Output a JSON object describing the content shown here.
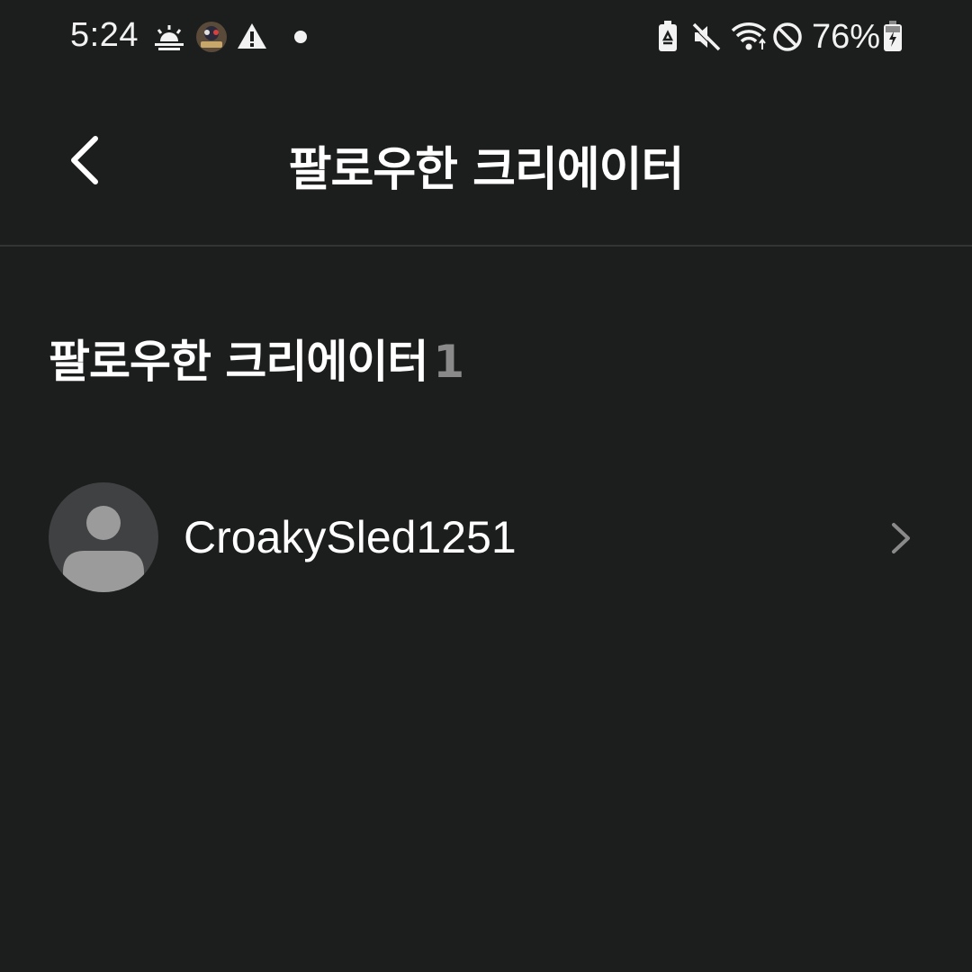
{
  "status_bar": {
    "time": "5:24",
    "battery_percent": "76%",
    "icons": [
      "weather-sunrise-icon",
      "app-notification-icon",
      "warning-icon",
      "dot-icon",
      "battery-saver-icon",
      "mute-icon",
      "wifi-icon",
      "do-not-disturb-icon",
      "battery-charging-icon"
    ]
  },
  "header": {
    "title": "팔로우한 크리에이터",
    "back_icon": "chevron-left-icon"
  },
  "section": {
    "heading": "팔로우한 크리에이터",
    "count": "1"
  },
  "creators": [
    {
      "name": "CroakySled1251",
      "avatar": "default-user-avatar",
      "trailing_icon": "chevron-right-icon"
    }
  ],
  "colors": {
    "background": "#1c1d1d",
    "text_primary": "#ffffff",
    "text_secondary": "#8a8a8a",
    "divider": "#333535",
    "avatar_bg": "#404142",
    "avatar_fg": "#9b9b9b"
  }
}
